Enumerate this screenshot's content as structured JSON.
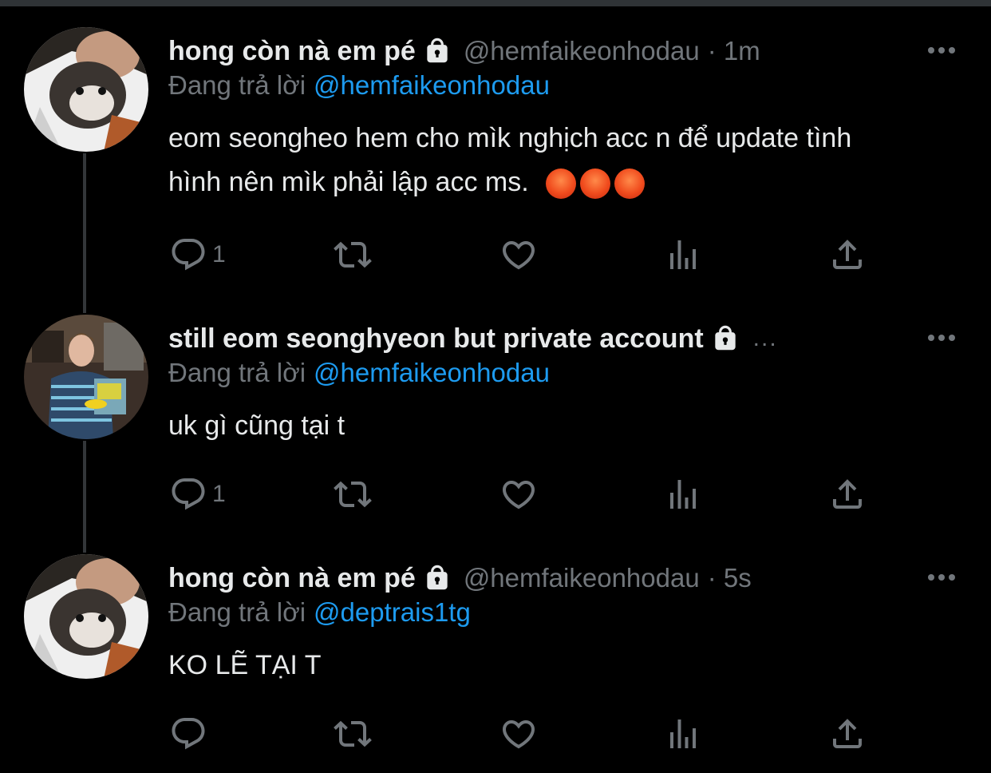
{
  "reply_prefix": "Đang trả lời",
  "tweets": [
    {
      "name": "hong còn nà em pé",
      "handle": "@hemfaikeonhodau",
      "time": "· 1m",
      "reply_to": "@hemfaikeonhodau",
      "text_line1": "eom seongheo hem cho mìk nghịch acc n để update tình",
      "text_line2": "hình nên mìk phải lập acc ms.",
      "emojis": [
        "angry-face",
        "angry-face",
        "angry-face"
      ],
      "reply_count": "1"
    },
    {
      "name": "still eom seonghyeon but private account",
      "truncation": "...",
      "reply_to": "@hemfaikeonhodau",
      "text_line1": "uk gì cũng tại t",
      "reply_count": "1"
    },
    {
      "name": "hong còn nà em pé",
      "handle": "@hemfaikeonhodau",
      "time": "· 5s",
      "reply_to": "@deptrais1tg",
      "text_line1": "KO LẼ TẠI T",
      "reply_count": ""
    }
  ],
  "colors": {
    "background": "#000000",
    "text": "#e7e9ea",
    "muted": "#71767b",
    "link": "#1d9bf0",
    "thread_line": "#333639"
  },
  "icons": [
    "reply-icon",
    "retweet-icon",
    "like-icon",
    "views-icon",
    "share-icon",
    "lock-icon",
    "more-icon"
  ]
}
